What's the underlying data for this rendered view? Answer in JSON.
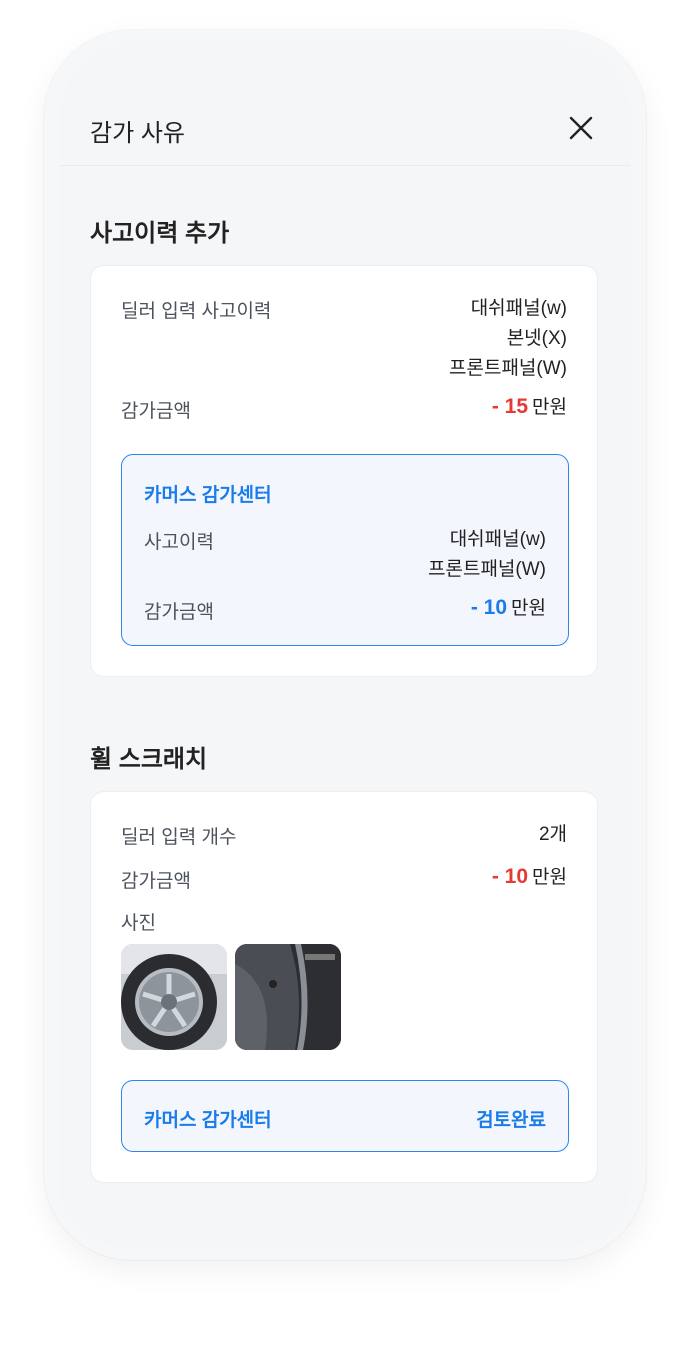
{
  "header": {
    "title": "감가 사유"
  },
  "accident": {
    "section_title": "사고이력 추가",
    "dealer_label": "딜러 입력 사고이력",
    "dealer_items": [
      "대쉬패널(w)",
      "본넷(X)",
      "프론트패널(W)"
    ],
    "amount_label": "감가금액",
    "amount_value": "- 15",
    "amount_unit": "만원",
    "center": {
      "title": "카머스 감가센터",
      "history_label": "사고이력",
      "history_items": [
        "대쉬패널(w)",
        "프론트패널(W)"
      ],
      "amount_label": "감가금액",
      "amount_value": "- 10",
      "amount_unit": "만원"
    }
  },
  "wheel": {
    "section_title": "휠 스크래치",
    "count_label": "딜러 입력 개수",
    "count_value": "2개",
    "amount_label": "감가금액",
    "amount_value": "- 10",
    "amount_unit": "만원",
    "photo_label": "사진",
    "center_title": "카머스 감가센터",
    "center_status": "검토완료"
  },
  "colors": {
    "accent": "#1a7bea",
    "deduction": "#e53935"
  }
}
